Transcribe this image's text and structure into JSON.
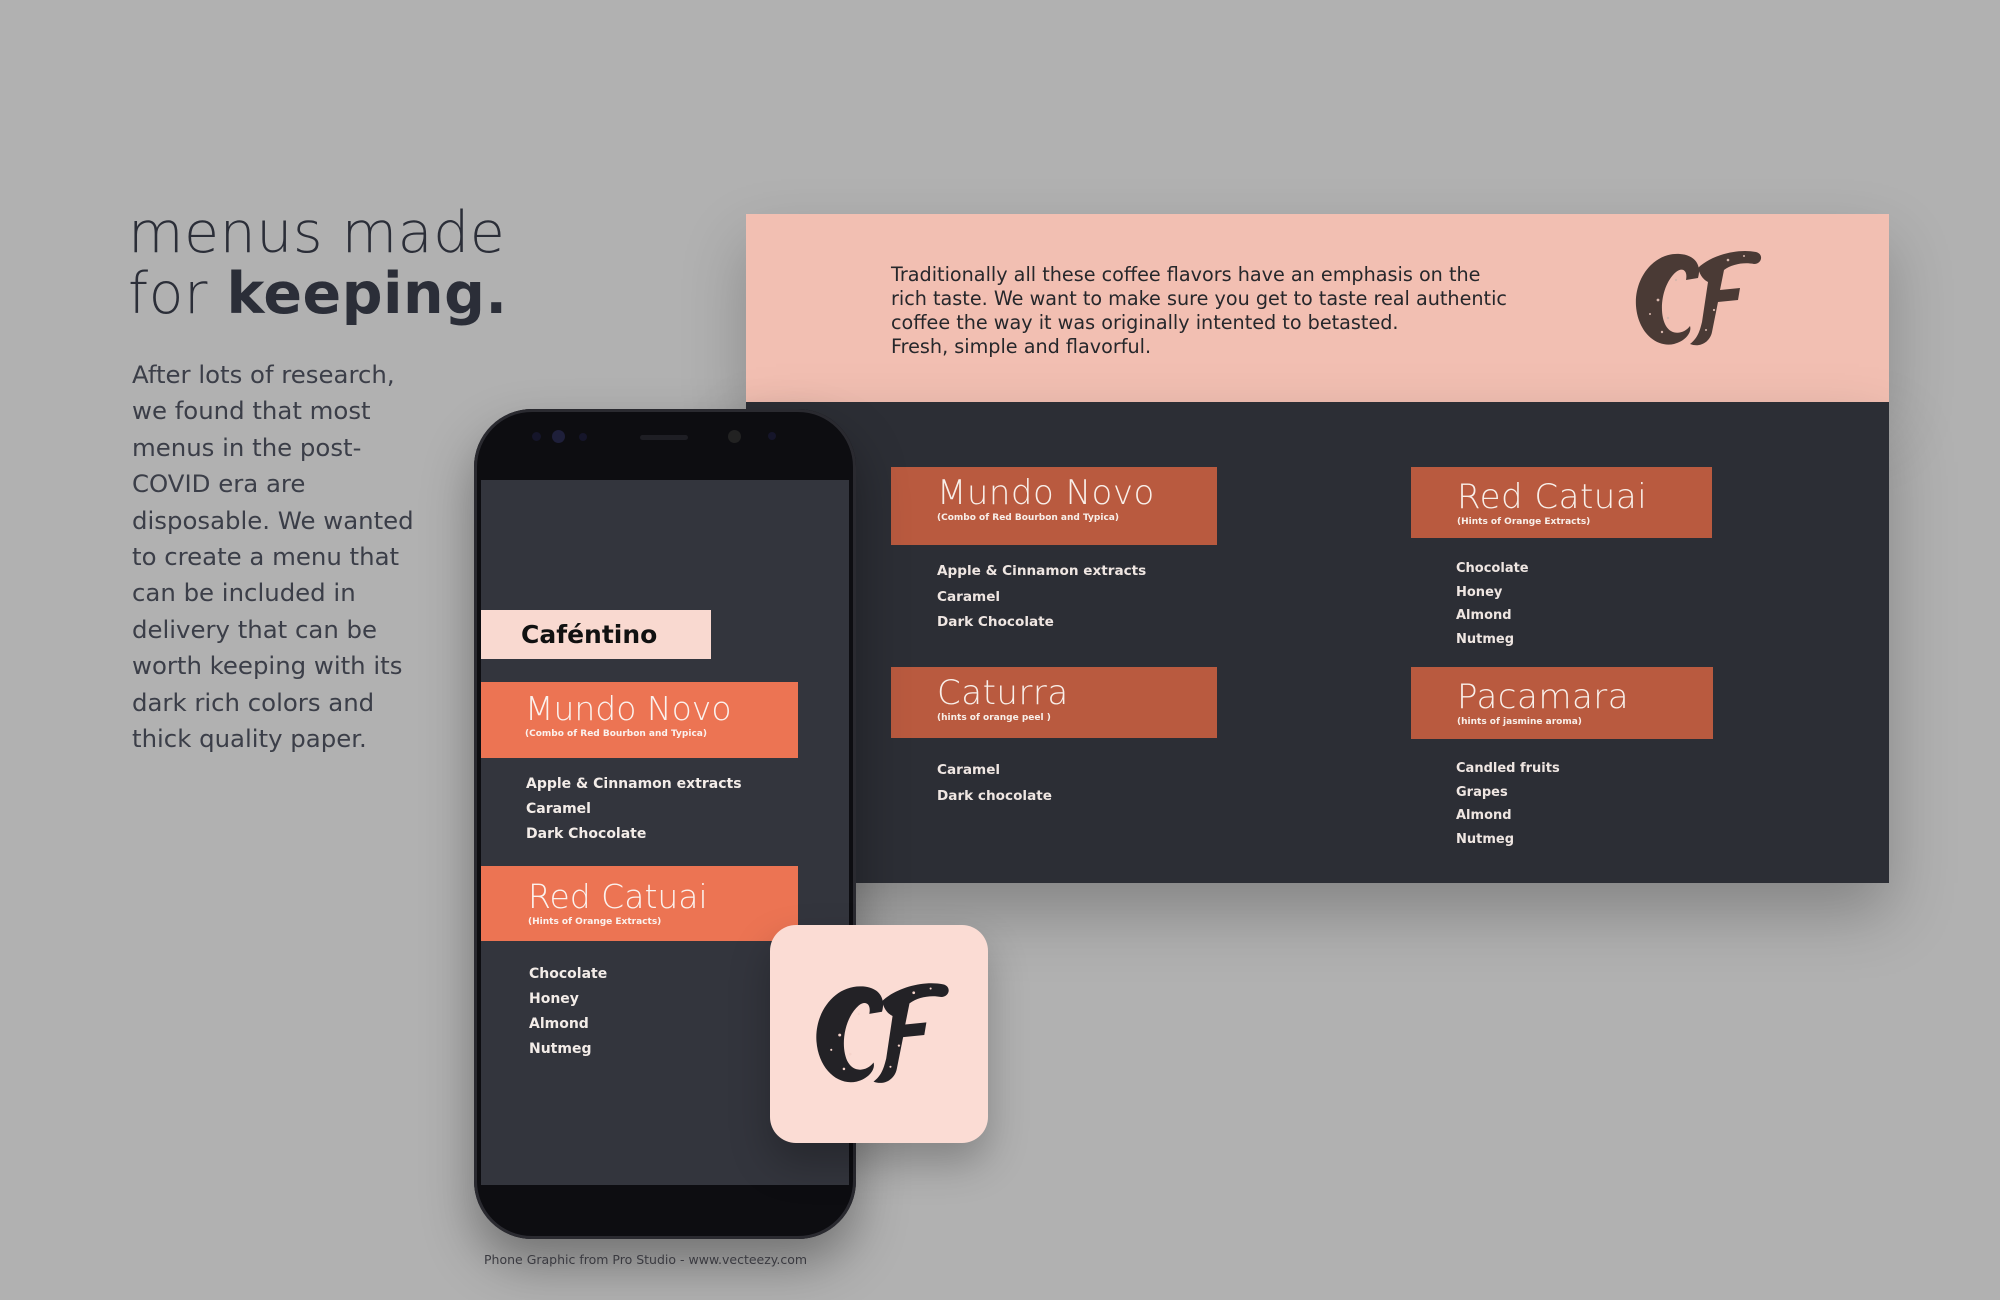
{
  "headline": {
    "line1": "menus made",
    "line2_pre": "for ",
    "line2_bold": "keeping."
  },
  "intro": "After lots of research, we found that most menus in the post-COVID era are disposable. We wanted to create a menu that can be included in delivery that can be worth keeping with its dark rich colors and thick quality paper.",
  "banner": {
    "tagline_lines": [
      "Traditionally all these coffee flavors have an emphasis on the",
      "rich taste. We want to make sure you get to taste real authentic",
      "coffee the way it was originally intented to betasted.",
      "Fresh, simple and flavorful."
    ],
    "logo_icon": "cf-monogram-icon",
    "items": [
      {
        "name": "Mundo Novo",
        "sub": "(Combo of Red Bourbon and Typica)",
        "notes": [
          "Apple & Cinnamon extracts",
          "Caramel",
          "Dark Chocolate"
        ]
      },
      {
        "name": "Red Catuai",
        "sub": "(Hints of Orange Extracts)",
        "notes": [
          "Chocolate",
          "Honey",
          "Almond",
          "Nutmeg"
        ]
      },
      {
        "name": "Caturra",
        "sub": "(hints of orange peel )",
        "notes": [
          "Caramel",
          "Dark chocolate"
        ]
      },
      {
        "name": "Pacamara",
        "sub": "(hints of jasmine aroma)",
        "notes": [
          "Candled fruits",
          "Grapes",
          "Almond",
          "Nutmeg"
        ]
      }
    ]
  },
  "phone": {
    "brand": "Caféntino",
    "items": [
      {
        "name": "Mundo Novo",
        "sub": "(Combo of Red Bourbon and Typica)",
        "notes": [
          "Apple & Cinnamon extracts",
          "Caramel",
          "Dark Chocolate"
        ]
      },
      {
        "name": "Red Catuai",
        "sub": "(Hints of Orange Extracts)",
        "notes": [
          "Chocolate",
          "Honey",
          "Almond",
          "Nutmeg"
        ]
      }
    ]
  },
  "app_icon": {
    "icon": "cf-monogram-icon"
  },
  "credit": "Phone Graphic from Pro Studio - www.vecteezy.com",
  "colors": {
    "background": "#b1b1b1",
    "peach": "#f2bfb2",
    "dark": "#2c2e35",
    "rust": "#b95a3f",
    "coral": "#ec7453",
    "icon_bg": "#fbdcd4"
  }
}
